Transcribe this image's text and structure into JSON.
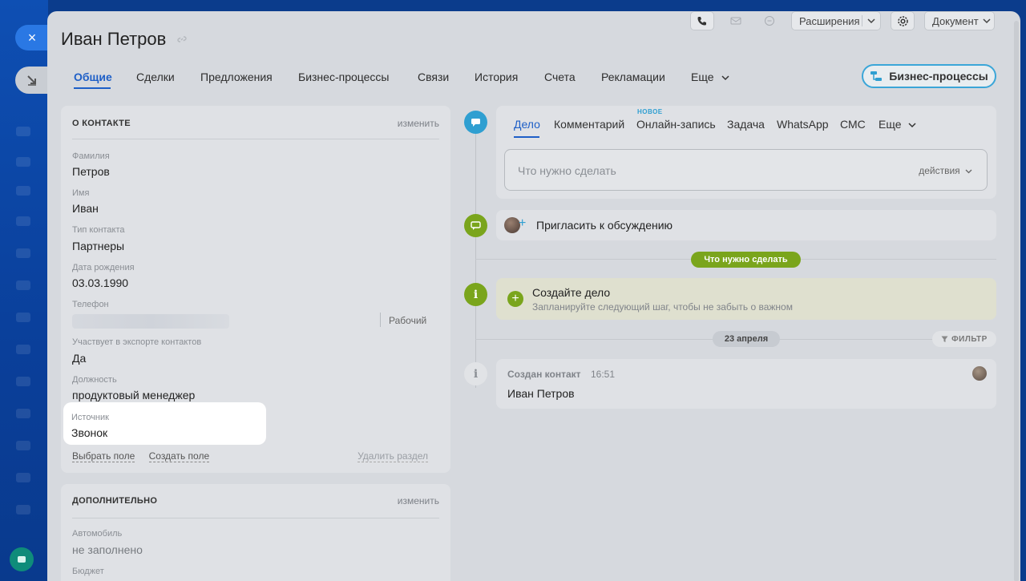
{
  "window": {
    "close_icon": "×"
  },
  "title": "Иван Петров",
  "toolbar": {
    "extensions_label": "Расширения",
    "document_label": "Документ"
  },
  "tabs": [
    {
      "label": "Общие"
    },
    {
      "label": "Сделки"
    },
    {
      "label": "Предложения"
    },
    {
      "label": "Бизнес-процессы"
    },
    {
      "label": "Связи"
    },
    {
      "label": "История"
    },
    {
      "label": "Счета"
    },
    {
      "label": "Рекламации"
    },
    {
      "label": "Еще"
    }
  ],
  "bp_button_label": "Бизнес-процессы",
  "contact_card": {
    "header": "О КОНТАКТЕ",
    "edit_label": "изменить",
    "fields": [
      {
        "label": "Фамилия",
        "value": "Петров"
      },
      {
        "label": "Имя",
        "value": "Иван"
      },
      {
        "label": "Тип контакта",
        "value": "Партнеры"
      },
      {
        "label": "Дата рождения",
        "value": "03.03.1990"
      },
      {
        "label": "Телефон",
        "value": ""
      },
      {
        "label": "Участвует в экспорте контактов",
        "value": "Да"
      },
      {
        "label": "Должность",
        "value": "продуктовый менеджер"
      },
      {
        "label": "Источник",
        "value": "Звонок"
      }
    ],
    "phone_type": "Рабочий",
    "select_field": "Выбрать поле",
    "create_field": "Создать поле",
    "remove_section": "Удалить раздел"
  },
  "extra_card": {
    "header": "ДОПОЛНИТЕЛЬНО",
    "edit_label": "изменить",
    "fields": [
      {
        "label": "Автомобиль",
        "value": "не заполнено"
      },
      {
        "label": "Бюджет",
        "value": ""
      }
    ]
  },
  "composer": {
    "tabs": [
      {
        "label": "Дело"
      },
      {
        "label": "Комментарий"
      },
      {
        "label": "Онлайн-запись"
      },
      {
        "label": "Задача"
      },
      {
        "label": "WhatsApp"
      },
      {
        "label": "СМС"
      },
      {
        "label": "Еще"
      }
    ],
    "new_badge": "НОВОЕ",
    "placeholder": "Что нужно сделать",
    "actions_label": "действия"
  },
  "invite_label": "Пригласить к обсуждению",
  "todo_pill": "Что нужно сделать",
  "todo": {
    "title": "Создайте дело",
    "subtitle": "Запланируйте следующий шаг, чтобы не забыть о важном"
  },
  "date_pill": "23 апреля",
  "filter_label": "ФИЛЬТР",
  "event": {
    "title": "Создан контакт",
    "time": "16:51",
    "body": "Иван Петров"
  },
  "colors": {
    "accent": "#1e5fc7",
    "green": "#7aa51c",
    "cyan": "#2f9fd1"
  }
}
